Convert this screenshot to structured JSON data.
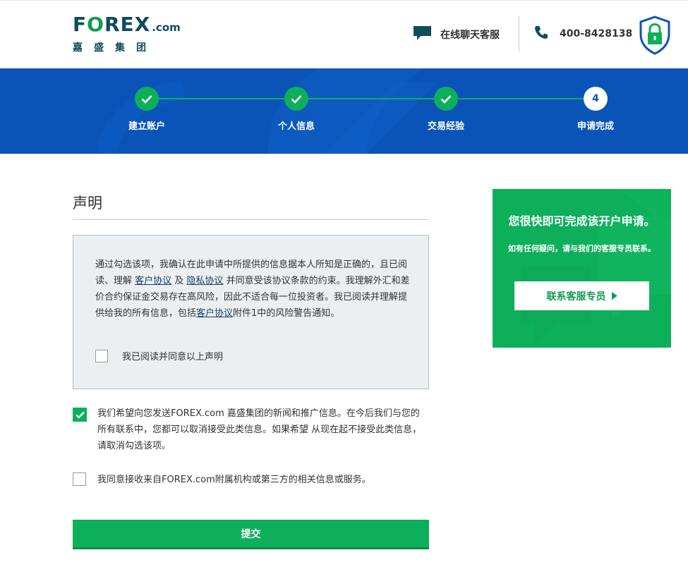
{
  "header": {
    "logo": {
      "word_pre": "F",
      "word_o": "O",
      "word_post": "REX",
      "word_com": ".com",
      "subtitle": "嘉盛集团"
    },
    "chat_label": "在线聊天客服",
    "phone": "400-8428138",
    "icons": {
      "chat": "chat-bubble-icon",
      "phone": "phone-icon",
      "security": "shield-lock-icon"
    }
  },
  "progress": {
    "steps": [
      {
        "label": "建立账户",
        "state": "done"
      },
      {
        "label": "个人信息",
        "state": "done"
      },
      {
        "label": "交易经验",
        "state": "done"
      },
      {
        "label": "申请完成",
        "state": "current",
        "number": "4"
      }
    ]
  },
  "main": {
    "title": "声明",
    "declaration": {
      "part1": "通过勾选该项，我确认在此申请中所提供的信息据本人所知是正确的，且已阅读、理解 ",
      "link_client_agreement": "客户协议",
      "part2": " 及 ",
      "link_privacy": "隐私协议",
      "part3": " 并同意受该协议条款的约束。我理解外汇和差价合约保证金交易存在高风险，因此不适合每一位投资者。我已阅读并理解提供给我的所有信息，包括",
      "link_client_agreement_2": "客户协议",
      "part4": "附件1中的风险警告通知。",
      "agree_label": "我已阅读并同意以上声明",
      "agree_checked": false
    },
    "option_news": {
      "text": "我们希望向您发送FOREX.com 嘉盛集团的新闻和推广信息。在今后我们与您的所有联系中，您都可以取消接受此类信息。如果希望 从现在起不接受此类信息，请取消勾选该项。",
      "checked": true
    },
    "option_third_party": {
      "text": "我同意接收来自FOREX.com附属机构或第三方的相关信息或服务。",
      "checked": false
    },
    "submit_label": "提交"
  },
  "side_panel": {
    "title": "您很快即可完成该开户申请。",
    "text": "如有任何疑问，请与我们的客服专员联系。",
    "button_label": "联系客服专员",
    "button_icon": "caret-right-icon"
  },
  "colors": {
    "brand_green": "#0eaf5b",
    "band_blue": "#0a54b8",
    "logo_navy": "#0f4c5c",
    "decl_bg": "#ebeff1"
  }
}
